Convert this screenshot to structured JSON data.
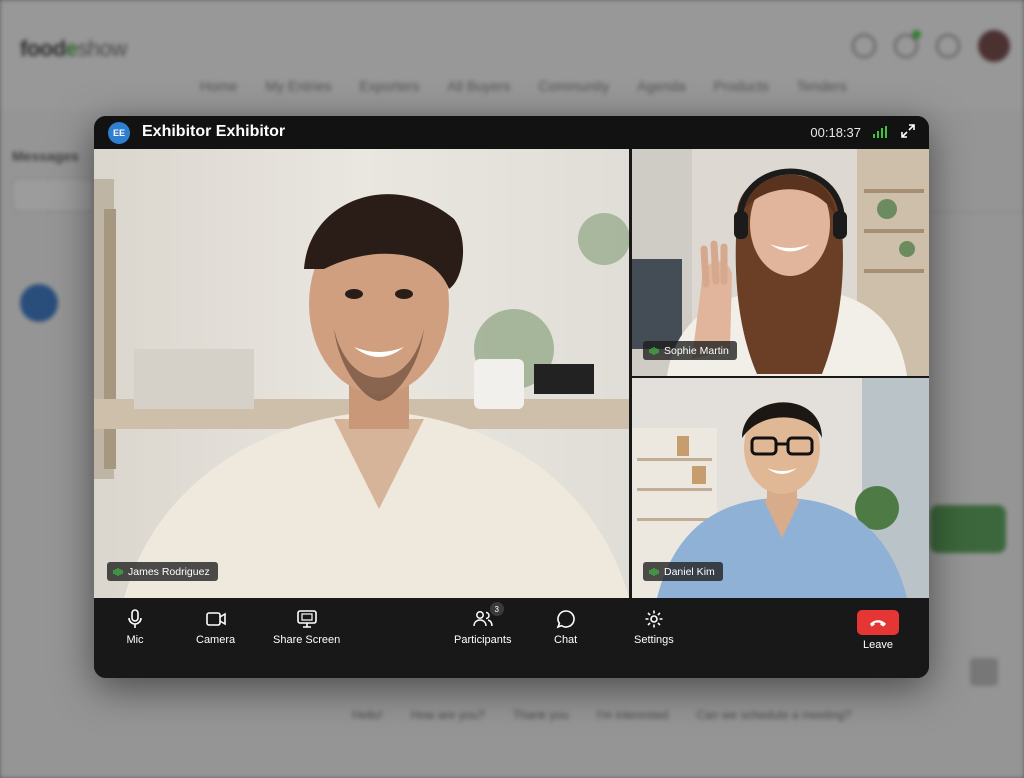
{
  "background": {
    "logo": {
      "part1": "food",
      "part2": "e",
      "part3": "show"
    },
    "nav": [
      "Home",
      "My Entries",
      "Exporters",
      "All Buyers",
      "Community",
      "Agenda",
      "Products",
      "Tenders"
    ],
    "messages_title": "Messages",
    "quick_replies": [
      "Hello!",
      "How are you?",
      "Thank you",
      "I'm interested",
      "Can we schedule a meeting?"
    ]
  },
  "call": {
    "avatar_initials": "EE",
    "title": "Exhibitor Exhibitor",
    "timer": "00:18:37",
    "colors": {
      "accent": "#3fc43f",
      "leave": "#e53535",
      "avatar": "#2f7fd0"
    },
    "participants": [
      {
        "name": "James Rodriguez",
        "speaking": true
      },
      {
        "name": "Sophie Martin",
        "speaking": true
      },
      {
        "name": "Daniel Kim",
        "speaking": true
      }
    ],
    "controls": {
      "mic": "Mic",
      "camera": "Camera",
      "share": "Share Screen",
      "participants": "Participants",
      "participants_count": "3",
      "chat": "Chat",
      "settings": "Settings",
      "leave": "Leave"
    }
  }
}
